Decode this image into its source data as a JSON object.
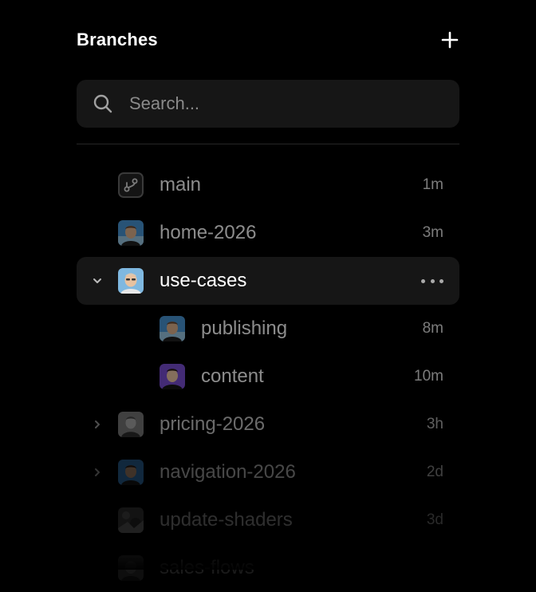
{
  "header": {
    "title": "Branches"
  },
  "search": {
    "placeholder": "Search..."
  },
  "branches": [
    {
      "name": "main",
      "time": "1m",
      "avatar": "branch-icon"
    },
    {
      "name": "home-2026",
      "time": "3m",
      "avatar": "user-avatar"
    },
    {
      "name": "use-cases",
      "time": "",
      "avatar": "user-avatar",
      "selected": true,
      "expanded": true
    },
    {
      "name": "publishing",
      "time": "8m",
      "avatar": "user-avatar",
      "child": true
    },
    {
      "name": "content",
      "time": "10m",
      "avatar": "user-avatar",
      "child": true
    },
    {
      "name": "pricing-2026",
      "time": "3h",
      "avatar": "user-avatar"
    },
    {
      "name": "navigation-2026",
      "time": "2d",
      "avatar": "user-avatar"
    },
    {
      "name": "update-shaders",
      "time": "3d",
      "avatar": "user-avatar"
    },
    {
      "name": "sales-flows",
      "time": "",
      "avatar": "user-avatar"
    }
  ],
  "colors": {
    "background": "#000000",
    "surface": "#161616",
    "text_primary": "#ffffff",
    "accent_purple": "#7b4fd6",
    "accent_blue": "#3f8fd9"
  }
}
